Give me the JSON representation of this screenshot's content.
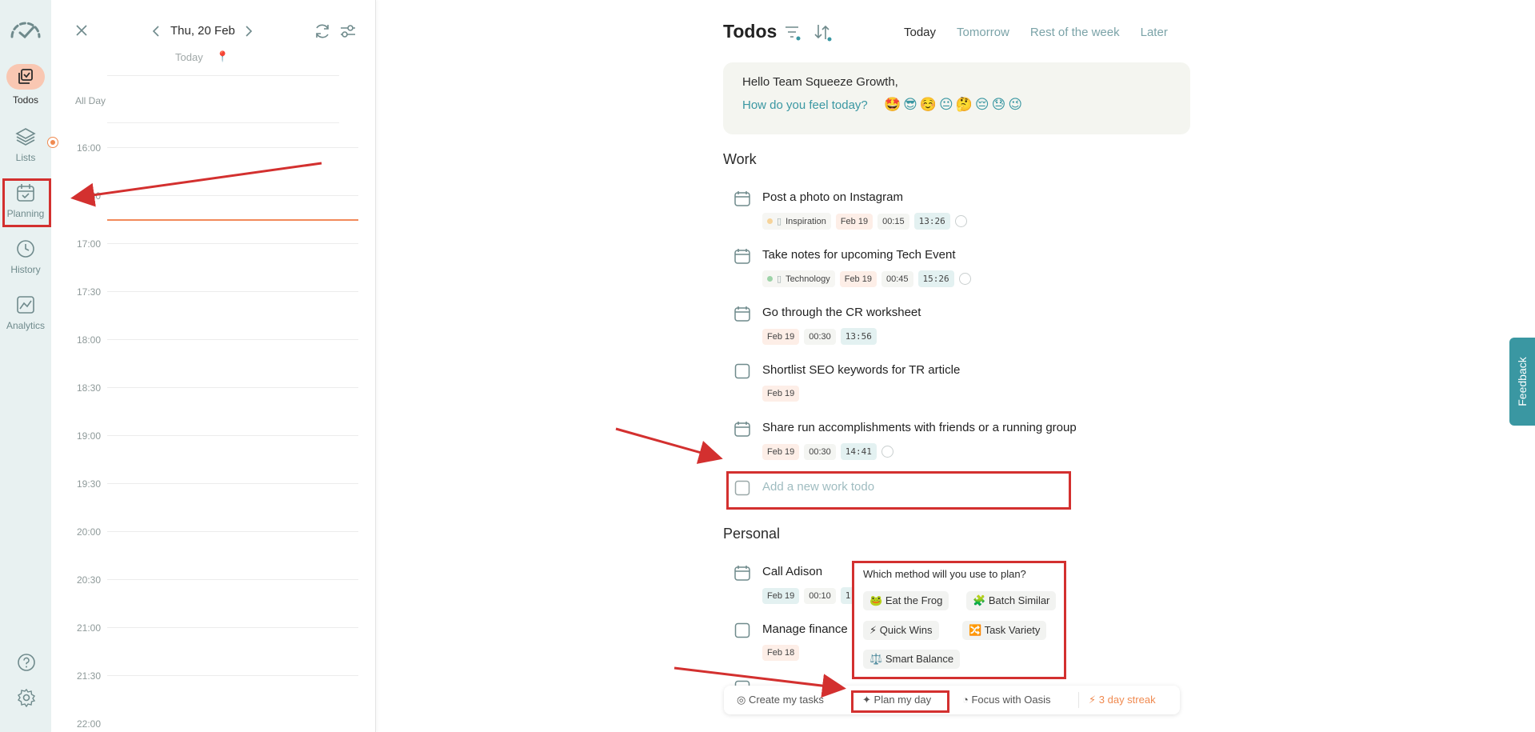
{
  "nav": {
    "items": [
      {
        "label": "Todos",
        "icon": "todos-icon"
      },
      {
        "label": "Lists",
        "icon": "layers-icon"
      },
      {
        "label": "Planning",
        "icon": "calendar-check-icon"
      },
      {
        "label": "History",
        "icon": "history-icon"
      },
      {
        "label": "Analytics",
        "icon": "analytics-icon"
      }
    ]
  },
  "calendar": {
    "date": "Thu, 20 Feb",
    "today_label": "Today",
    "all_day": "All Day",
    "times": [
      "16:00",
      "17:00",
      "17:30",
      "18:00",
      "18:30",
      "19:00",
      "19:30",
      "20:00",
      "20:30",
      "21:00",
      "21:30",
      "22:00"
    ],
    "partial_time": "30"
  },
  "main": {
    "title": "Todos",
    "tabs": [
      "Today",
      "Tomorrow",
      "Rest of the week",
      "Later"
    ],
    "greeting": "Hello Team Squeeze Growth,",
    "feel_question": "How do you feel today?",
    "emojis": "🤩😎☺️😐🤔😔😓😉",
    "sections": {
      "work": "Work",
      "personal": "Personal"
    },
    "work_todos": [
      {
        "text": "Post a photo on Instagram",
        "tag": "Inspiration",
        "tag_color": "#f6d39a",
        "date": "Feb 19",
        "duration": "00:15",
        "timer": "13:26"
      },
      {
        "text": "Take notes for upcoming Tech Event",
        "tag": "Technology",
        "tag_color": "#9dd3a8",
        "date": "Feb 19",
        "duration": "00:45",
        "timer": "15:26"
      },
      {
        "text": "Go through the CR worksheet",
        "date": "Feb 19",
        "duration": "00:30",
        "timer": "13:56"
      },
      {
        "text": "Shortlist SEO keywords for TR article",
        "date": "Feb 19"
      },
      {
        "text": "Share run accomplishments with friends or a running group",
        "date": "Feb 19",
        "duration": "00:30",
        "timer": "14:41"
      }
    ],
    "add_work_placeholder": "Add a new work todo",
    "personal_todos": [
      {
        "text": "Call Adison",
        "date": "Feb 19",
        "duration": "00:10",
        "timer_partial": "1"
      },
      {
        "text": "Manage finance",
        "date": "Feb 18"
      }
    ]
  },
  "popup": {
    "question": "Which method will you use to plan?",
    "options": [
      {
        "label": "Eat the Frog",
        "icon": "🐸"
      },
      {
        "label": "Batch Similar",
        "icon": "🧩"
      },
      {
        "label": "Quick Wins",
        "icon": "⚡"
      },
      {
        "label": "Task Variety",
        "icon": "🔀"
      },
      {
        "label": "Smart Balance",
        "icon": "⚖️"
      }
    ]
  },
  "bottom_bar": {
    "create": "Create my tasks",
    "plan": "Plan my day",
    "focus": "Focus with Oasis",
    "streak": "3 day streak"
  },
  "feedback": "Feedback",
  "colors": {
    "accent": "#3a97a2",
    "highlight": "#d3302f",
    "now_line": "#f28a5a",
    "streak": "#f08a50"
  }
}
